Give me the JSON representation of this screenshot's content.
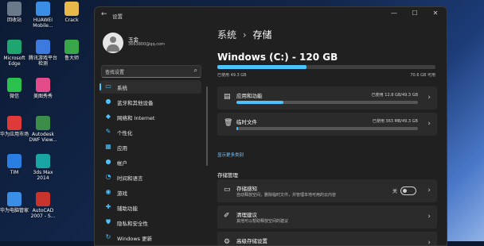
{
  "desktop": {
    "icons": [
      {
        "name": "recycle-bin",
        "label": "回收站",
        "color": "#6a7a8a"
      },
      {
        "name": "huawei-mobile",
        "label": "HUAWEI Mobile...",
        "color": "#3a8ee6"
      },
      {
        "name": "crack-folder",
        "label": "Crack",
        "color": "#e8b84a"
      },
      {
        "name": "microsoft-edge",
        "label": "Microsoft Edge",
        "color": "#1fa56f"
      },
      {
        "name": "tencent-games",
        "label": "腾讯游戏平台检测",
        "color": "#3c7ae0"
      },
      {
        "name": "lubai-tool",
        "label": "鲁大师",
        "color": "#3aa64a"
      },
      {
        "name": "wechat",
        "label": "微信",
        "color": "#2bc14d"
      },
      {
        "name": "meitu",
        "label": "美图秀秀",
        "color": "#e34b8a"
      },
      {
        "name": "huawei-app-market",
        "label": "华为应用市场",
        "color": "#e0393a"
      },
      {
        "name": "autodesk-dwf",
        "label": "Autodesk DWF View...",
        "color": "#3c8c4a"
      },
      {
        "name": "tim",
        "label": "TIM",
        "color": "#2a7de1"
      },
      {
        "name": "3ds-max",
        "label": "3ds Max 2014",
        "color": "#1aa5a5"
      },
      {
        "name": "huawei-computer-manager",
        "label": "华为电脑管家",
        "color": "#3a8ee6"
      },
      {
        "name": "autocad",
        "label": "AutoCAD 2007 - S...",
        "color": "#c8342c"
      }
    ]
  },
  "window": {
    "title": "设置",
    "back_icon": "←",
    "minimize": "—",
    "maximize": "☐",
    "close": "✕"
  },
  "user": {
    "name": "玉金",
    "email": "3663800@qq.com"
  },
  "search": {
    "placeholder": "查找设置"
  },
  "nav": [
    {
      "label": "系统",
      "icon": "▭",
      "selected": true
    },
    {
      "label": "蓝牙和其他设备",
      "icon": "●"
    },
    {
      "label": "网络和 Internet",
      "icon": "◆"
    },
    {
      "label": "个性化",
      "icon": "✎"
    },
    {
      "label": "应用",
      "icon": "▦"
    },
    {
      "label": "帐户",
      "icon": "●"
    },
    {
      "label": "时间和语言",
      "icon": "◔"
    },
    {
      "label": "游戏",
      "icon": "◉"
    },
    {
      "label": "辅助功能",
      "icon": "✚"
    },
    {
      "label": "隐私和安全性",
      "icon": "⛊"
    },
    {
      "label": "Windows 更新",
      "icon": "↻"
    }
  ],
  "breadcrumb": {
    "parent": "系统",
    "sep": "›",
    "current": "存储"
  },
  "drive": {
    "title": "Windows (C:) - 120 GB",
    "used": "已使用 49.3 GB",
    "free": "70.6 GB 可用",
    "fill_pct": 41
  },
  "cards": [
    {
      "title": "应用和功能",
      "value": "已使用 12.8 GB/49.3 GB",
      "icon": "▤",
      "fill_pct": 26
    },
    {
      "title": "临时文件",
      "value": "已使用 363 MB/49.3 GB",
      "icon": "🗑",
      "fill_pct": 1
    }
  ],
  "show_more": "显示更多类别",
  "storage_mgmt": {
    "title": "存储管理",
    "items": [
      {
        "title": "存储感知",
        "sub": "自动释放空间，删除临时文件，并管理本地可用的云内容",
        "icon": "▭",
        "toggle_label": "关"
      },
      {
        "title": "清理建议",
        "sub": "其他可以帮助释放空间的建议",
        "icon": "✐"
      },
      {
        "title": "高级存储设置",
        "sub": "",
        "icon": "⚙"
      }
    ]
  }
}
